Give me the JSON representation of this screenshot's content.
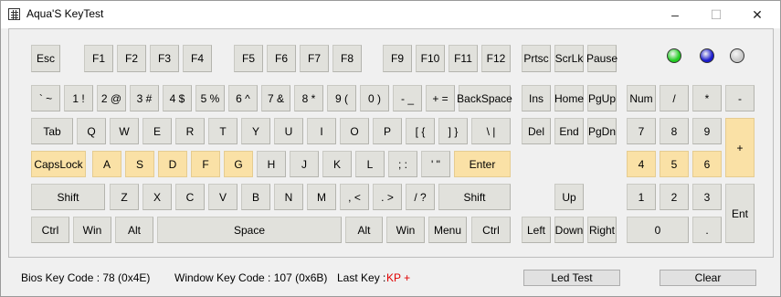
{
  "window": {
    "title": "Aqua'S KeyTest",
    "minimize": "–",
    "maximize": "☐",
    "close": "✕"
  },
  "leds": [
    "#22cc22",
    "#1a1acc",
    "#c8c8c8"
  ],
  "keys": {
    "esc": "Esc",
    "f1": "F1",
    "f2": "F2",
    "f3": "F3",
    "f4": "F4",
    "f5": "F5",
    "f6": "F6",
    "f7": "F7",
    "f8": "F8",
    "f9": "F9",
    "f10": "F10",
    "f11": "F11",
    "f12": "F12",
    "prtsc": "Prtsc",
    "scrlk": "ScrLk",
    "pause": "Pause",
    "grave": "` ~",
    "1": "1 !",
    "2": "2 @",
    "3": "3 #",
    "4": "4 $",
    "5": "5 %",
    "6": "6 ^",
    "7": "7 &",
    "8": "8 *",
    "9": "9 (",
    "0": "0 )",
    "minus": "- _",
    "equal": "+ =",
    "backspace": "BackSpace",
    "ins": "Ins",
    "home": "Home",
    "pgup": "PgUp",
    "numlock": "Num",
    "np_div": "/",
    "np_mul": "*",
    "np_sub": "-",
    "tab": "Tab",
    "q": "Q",
    "w": "W",
    "e": "E",
    "r": "R",
    "t": "T",
    "y": "Y",
    "u": "U",
    "i": "I",
    "o": "O",
    "p": "P",
    "lbracket": "[ {",
    "rbracket": "] }",
    "backslash": "\\ |",
    "del": "Del",
    "end": "End",
    "pgdn": "PgDn",
    "np7": "7",
    "np8": "8",
    "np9": "9",
    "np_add": "+",
    "capslock": "CapsLock",
    "a": "A",
    "s": "S",
    "d": "D",
    "f": "F",
    "g": "G",
    "h": "H",
    "j": "J",
    "k": "K",
    "l": "L",
    "semicolon": "; :",
    "quote": "' \"",
    "enter": "Enter",
    "np4": "4",
    "np5": "5",
    "np6": "6",
    "lshift": "Shift",
    "z": "Z",
    "x": "X",
    "c": "C",
    "v": "V",
    "b": "B",
    "n": "N",
    "m": "M",
    "comma": ", <",
    "period": ". >",
    "slash": "/ ?",
    "rshift": "Shift",
    "up": "Up",
    "np1": "1",
    "np2": "2",
    "np3": "3",
    "np_enter": "Ent",
    "lctrl": "Ctrl",
    "lwin": "Win",
    "lalt": "Alt",
    "space": "Space",
    "ralt": "Alt",
    "rwin": "Win",
    "menu": "Menu",
    "rctrl": "Ctrl",
    "left": "Left",
    "down": "Down",
    "right": "Right",
    "np0": "0",
    "np_dot": "."
  },
  "status": {
    "bios_code": "Bios Key Code : 78 (0x4E)",
    "window_code": "Window Key Code : 107 (0x6B)",
    "last_key_label": "Last Key :",
    "last_key_value": "KP +",
    "led_test": "Led Test",
    "clear": "Clear"
  }
}
